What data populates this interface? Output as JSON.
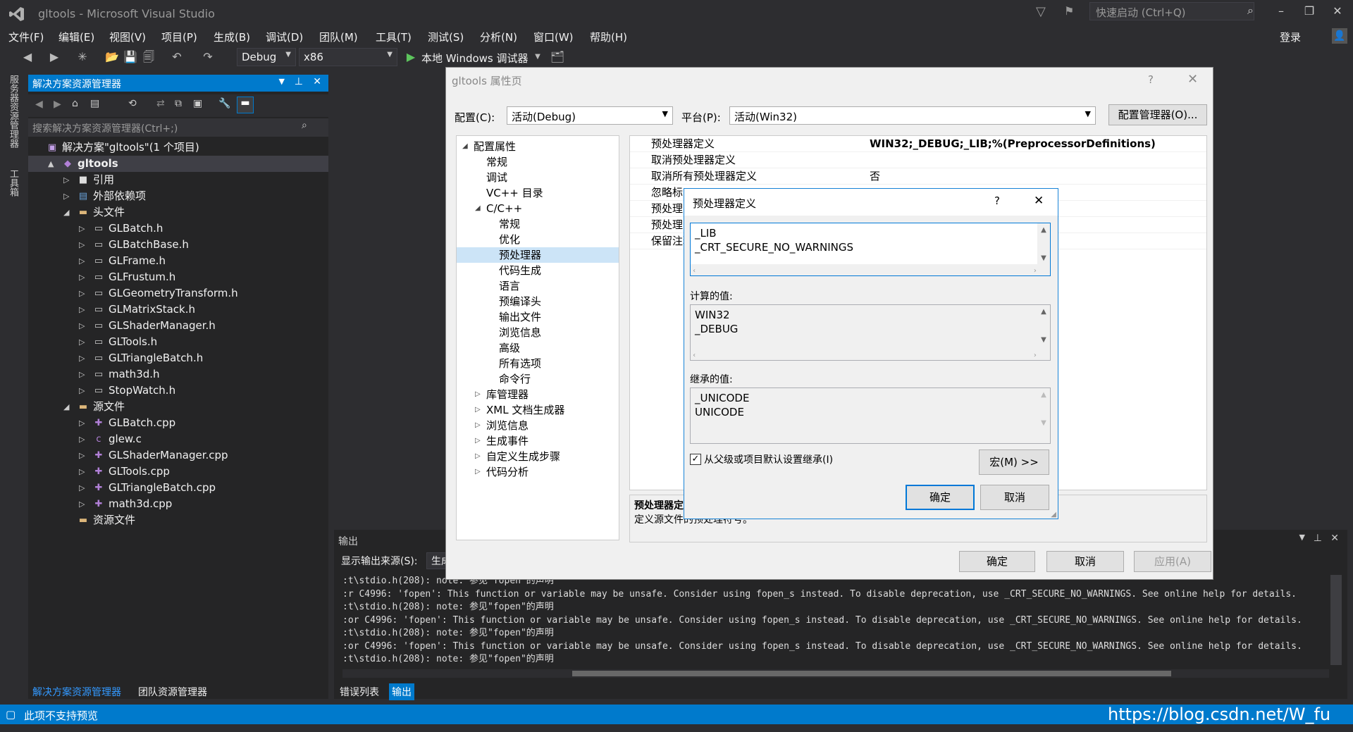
{
  "window": {
    "title": "gltools - Microsoft Visual Studio",
    "quick_launch": "快速启动 (Ctrl+Q)",
    "login": "登录"
  },
  "menu": [
    "文件(F)",
    "编辑(E)",
    "视图(V)",
    "项目(P)",
    "生成(B)",
    "调试(D)",
    "团队(M)",
    "工具(T)",
    "测试(S)",
    "分析(N)",
    "窗口(W)",
    "帮助(H)"
  ],
  "toolbar": {
    "config": "Debug",
    "platform": "x86",
    "run_label": "本地 Windows 调试器"
  },
  "side_tabs": [
    "服务器资源管理器",
    "工具箱"
  ],
  "solution_explorer": {
    "title": "解决方案资源管理器",
    "search_placeholder": "搜索解决方案资源管理器(Ctrl+;)",
    "items": [
      {
        "label": "解决方案\"gltools\"(1 个项目)",
        "level": 0,
        "icon": "solution-icon",
        "exp": ""
      },
      {
        "label": "gltools",
        "level": 1,
        "icon": "project-icon",
        "exp": "▲",
        "selected": true,
        "bold": true
      },
      {
        "label": "引用",
        "level": 2,
        "icon": "references-icon",
        "exp": "▷"
      },
      {
        "label": "外部依赖项",
        "level": 2,
        "icon": "external-deps-icon",
        "exp": "▷"
      },
      {
        "label": "头文件",
        "level": 2,
        "icon": "folder-icon",
        "exp": "◢"
      },
      {
        "label": "GLBatch.h",
        "level": 3,
        "icon": "header-file-icon",
        "exp": "▷"
      },
      {
        "label": "GLBatchBase.h",
        "level": 3,
        "icon": "header-file-icon",
        "exp": "▷"
      },
      {
        "label": "GLFrame.h",
        "level": 3,
        "icon": "header-file-icon",
        "exp": "▷"
      },
      {
        "label": "GLFrustum.h",
        "level": 3,
        "icon": "header-file-icon",
        "exp": "▷"
      },
      {
        "label": "GLGeometryTransform.h",
        "level": 3,
        "icon": "header-file-icon",
        "exp": "▷"
      },
      {
        "label": "GLMatrixStack.h",
        "level": 3,
        "icon": "header-file-icon",
        "exp": "▷"
      },
      {
        "label": "GLShaderManager.h",
        "level": 3,
        "icon": "header-file-icon",
        "exp": "▷"
      },
      {
        "label": "GLTools.h",
        "level": 3,
        "icon": "header-file-icon",
        "exp": "▷"
      },
      {
        "label": "GLTriangleBatch.h",
        "level": 3,
        "icon": "header-file-icon",
        "exp": "▷"
      },
      {
        "label": "math3d.h",
        "level": 3,
        "icon": "header-file-icon",
        "exp": "▷"
      },
      {
        "label": "StopWatch.h",
        "level": 3,
        "icon": "header-file-icon",
        "exp": "▷"
      },
      {
        "label": "源文件",
        "level": 2,
        "icon": "folder-icon",
        "exp": "◢"
      },
      {
        "label": "GLBatch.cpp",
        "level": 3,
        "icon": "cpp-file-icon",
        "exp": "▷"
      },
      {
        "label": "glew.c",
        "level": 3,
        "icon": "c-file-icon",
        "exp": "▷"
      },
      {
        "label": "GLShaderManager.cpp",
        "level": 3,
        "icon": "cpp-file-icon",
        "exp": "▷"
      },
      {
        "label": "GLTools.cpp",
        "level": 3,
        "icon": "cpp-file-icon",
        "exp": "▷"
      },
      {
        "label": "GLTriangleBatch.cpp",
        "level": 3,
        "icon": "cpp-file-icon",
        "exp": "▷"
      },
      {
        "label": "math3d.cpp",
        "level": 3,
        "icon": "cpp-file-icon",
        "exp": "▷"
      },
      {
        "label": "资源文件",
        "level": 2,
        "icon": "folder-icon",
        "exp": ""
      }
    ],
    "bottom_tabs": [
      "解决方案资源管理器",
      "团队资源管理器"
    ]
  },
  "output": {
    "title": "输出",
    "source_label": "显示输出来源(S):",
    "source_value": "生成",
    "lines": [
      ":t\\stdio.h(208): note: 参见\"fopen\"的声明",
      ":r C4996: 'fopen': This function or variable may be unsafe. Consider using fopen_s instead. To disable deprecation, use _CRT_SECURE_NO_WARNINGS. See online help for details.",
      ":t\\stdio.h(208): note: 参见\"fopen\"的声明",
      ":or C4996: 'fopen': This function or variable may be unsafe. Consider using fopen_s instead. To disable deprecation, use _CRT_SECURE_NO_WARNINGS. See online help for details.",
      ":t\\stdio.h(208): note: 参见\"fopen\"的声明",
      ":or C4996: 'fopen': This function or variable may be unsafe. Consider using fopen_s instead. To disable deprecation, use _CRT_SECURE_NO_WARNINGS. See online help for details.",
      ":t\\stdio.h(208): note: 参见\"fopen\"的声明"
    ],
    "tabs": [
      "错误列表",
      "输出"
    ]
  },
  "status": {
    "text": "此项不支持预览",
    "watermark": "https://blog.csdn.net/W_fu"
  },
  "prop_dialog": {
    "title": "gltools 属性页",
    "config_label": "配置(C):",
    "config_value": "活动(Debug)",
    "platform_label": "平台(P):",
    "platform_value": "活动(Win32)",
    "config_manager": "配置管理器(O)...",
    "tree": [
      {
        "label": "配置属性",
        "level": 0,
        "exp": "◢"
      },
      {
        "label": "常规",
        "level": 1,
        "exp": ""
      },
      {
        "label": "调试",
        "level": 1,
        "exp": ""
      },
      {
        "label": "VC++ 目录",
        "level": 1,
        "exp": ""
      },
      {
        "label": "C/C++",
        "level": 1,
        "exp": "◢"
      },
      {
        "label": "常规",
        "level": 2,
        "exp": ""
      },
      {
        "label": "优化",
        "level": 2,
        "exp": ""
      },
      {
        "label": "预处理器",
        "level": 2,
        "exp": "",
        "selected": true
      },
      {
        "label": "代码生成",
        "level": 2,
        "exp": ""
      },
      {
        "label": "语言",
        "level": 2,
        "exp": ""
      },
      {
        "label": "预编译头",
        "level": 2,
        "exp": ""
      },
      {
        "label": "输出文件",
        "level": 2,
        "exp": ""
      },
      {
        "label": "浏览信息",
        "level": 2,
        "exp": ""
      },
      {
        "label": "高级",
        "level": 2,
        "exp": ""
      },
      {
        "label": "所有选项",
        "level": 2,
        "exp": ""
      },
      {
        "label": "命令行",
        "level": 2,
        "exp": ""
      },
      {
        "label": "库管理器",
        "level": 1,
        "exp": "▷"
      },
      {
        "label": "XML 文档生成器",
        "level": 1,
        "exp": "▷"
      },
      {
        "label": "浏览信息",
        "level": 1,
        "exp": "▷"
      },
      {
        "label": "生成事件",
        "level": 1,
        "exp": "▷"
      },
      {
        "label": "自定义生成步骤",
        "level": 1,
        "exp": "▷"
      },
      {
        "label": "代码分析",
        "level": 1,
        "exp": "▷"
      }
    ],
    "grid": [
      {
        "name": "预处理器定义",
        "value": "WIN32;_DEBUG;_LIB;%(PreprocessorDefinitions)",
        "bold": true
      },
      {
        "name": "取消预处理器定义",
        "value": ""
      },
      {
        "name": "取消所有预处理器定义",
        "value": "否"
      },
      {
        "name": "忽略标",
        "value": ""
      },
      {
        "name": "预处理",
        "value": ""
      },
      {
        "name": "预处理",
        "value": ""
      },
      {
        "name": "保留注释",
        "value": ""
      }
    ],
    "desc_title": "预处理器定",
    "desc_text": "定义源文件的预处理符号。",
    "ok": "确定",
    "cancel": "取消",
    "apply": "应用(A)"
  },
  "pp_dialog": {
    "title": "预处理器定义",
    "help": "?",
    "edit_lines": [
      "_LIB",
      "_CRT_SECURE_NO_WARNINGS"
    ],
    "computed_label": "计算的值:",
    "computed_lines": [
      "WIN32",
      "_DEBUG"
    ],
    "inherited_label": "继承的值:",
    "inherited_lines": [
      "_UNICODE",
      "UNICODE"
    ],
    "inherit_checkbox": "从父级或项目默认设置继承(I)",
    "inherit_checked": true,
    "macro_button": "宏(M) >>",
    "ok": "确定",
    "cancel": "取消"
  }
}
